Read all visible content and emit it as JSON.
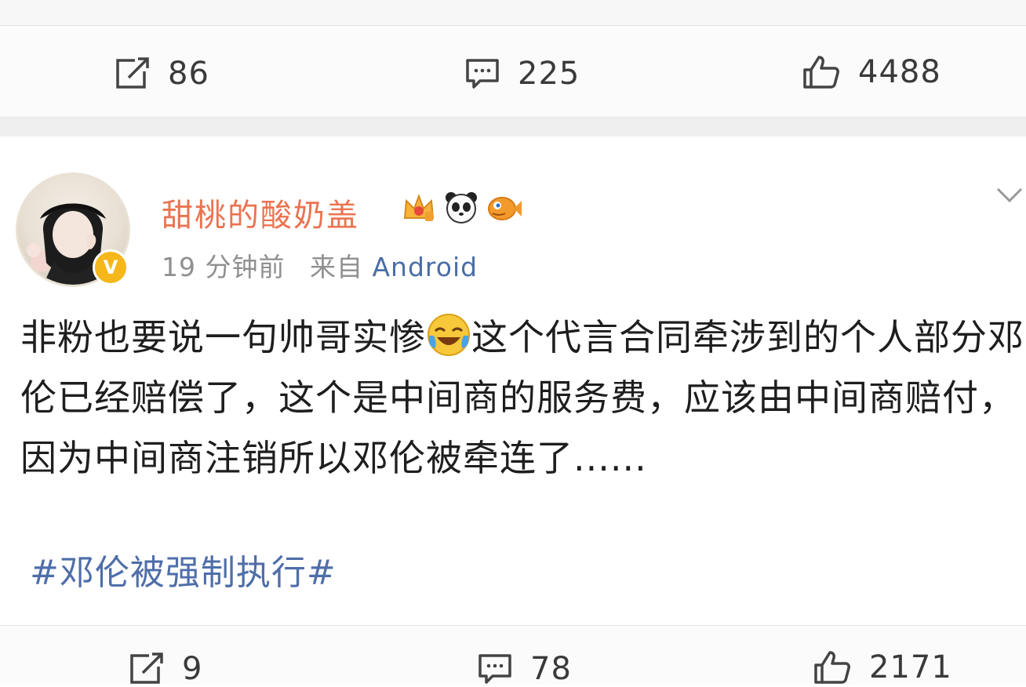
{
  "top_actions": {
    "repost": "86",
    "comment": "225",
    "like": "4488"
  },
  "post": {
    "username": "甜桃的酸奶盖",
    "time": "19 分钟前",
    "from_label": "来自",
    "source": "Android",
    "text_part1": "非粉也要说一句帅哥实惨",
    "text_part2": "这个代言合同牵涉到的个人部分邓伦已经赔偿了，这个是中间商的服务费，应该由中间商赔付，因为中间商注销所以邓伦被牵连了......",
    "hashtag": "#邓伦被强制执行#",
    "badges": [
      "crown-badge-icon",
      "panda-badge-icon",
      "fish-badge-icon"
    ],
    "verified_mark": "V"
  },
  "bottom_actions": {
    "repost": "9",
    "comment": "78",
    "like": "2171"
  },
  "colors": {
    "username": "#eb7350",
    "link": "#4f6ea9",
    "verified": "#f5b71a"
  }
}
